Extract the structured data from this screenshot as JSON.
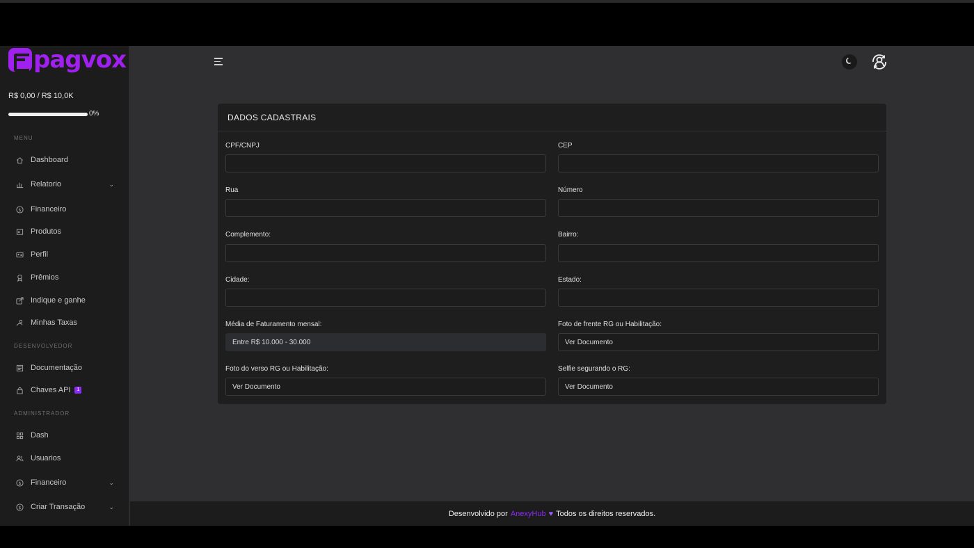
{
  "brand": {
    "logo_text": "pagvox",
    "accent": "#a020f0"
  },
  "sidebar": {
    "balance": "R$ 0,00 / R$ 10,0K",
    "progress_percent": 0,
    "progress_label": "0%",
    "sections": {
      "menu": "MENU",
      "dev": "DESENVOLVEDOR",
      "admin": "ADMINISTRADOR"
    },
    "items": [
      {
        "label": "Dashboard",
        "icon": "home-icon"
      },
      {
        "label": "Relatorio",
        "icon": "bar-chart-icon",
        "expandable": true
      },
      {
        "label": "Financeiro",
        "icon": "dollar-circle-icon"
      },
      {
        "label": "Produtos",
        "icon": "box-icon"
      },
      {
        "label": "Perfil",
        "icon": "id-card-icon"
      },
      {
        "label": "Prêmios",
        "icon": "award-icon"
      },
      {
        "label": "Indique e ganhe",
        "icon": "share-icon"
      },
      {
        "label": "Minhas Taxas",
        "icon": "hand-coin-icon"
      },
      {
        "label": "Documentação",
        "icon": "document-icon"
      },
      {
        "label": "Chaves API",
        "icon": "lock-icon",
        "badge": "1"
      },
      {
        "label": "Dash",
        "icon": "grid-icon"
      },
      {
        "label": "Usuarios",
        "icon": "users-icon"
      },
      {
        "label": "Financeiro",
        "icon": "dollar-circle-icon",
        "expandable": true
      },
      {
        "label": "Criar Transação",
        "icon": "dollar-circle-icon",
        "expandable": true
      }
    ]
  },
  "header": {
    "menu_icon": "hamburger-icon",
    "theme_icon": "moon-icon",
    "user_icon": "user-refresh-icon"
  },
  "form": {
    "title": "DADOS CADASTRAIS",
    "fields": [
      {
        "label": "CPF/CNPJ",
        "value": ""
      },
      {
        "label": "CEP",
        "value": ""
      },
      {
        "label": "Rua",
        "value": ""
      },
      {
        "label": "Número",
        "value": ""
      },
      {
        "label": "Complemento:",
        "value": ""
      },
      {
        "label": "Bairro:",
        "value": ""
      },
      {
        "label": "Cidade:",
        "value": ""
      },
      {
        "label": "Estado:",
        "value": ""
      },
      {
        "label": "Média de Faturamento mensal:",
        "value": "Entre R$ 10.000 - 30.000"
      },
      {
        "label": "Foto de frente RG ou Habilitação:",
        "value": "Ver Documento"
      },
      {
        "label": "Foto do verso RG ou Habilitação:",
        "value": "Ver Documento"
      },
      {
        "label": "Selfie segurando o RG:",
        "value": "Ver Documento"
      }
    ]
  },
  "footer": {
    "prefix": "Desenvolvido por",
    "brand": "AnexyHub",
    "heart": "♥",
    "suffix": "Todos os direitos reservados."
  }
}
